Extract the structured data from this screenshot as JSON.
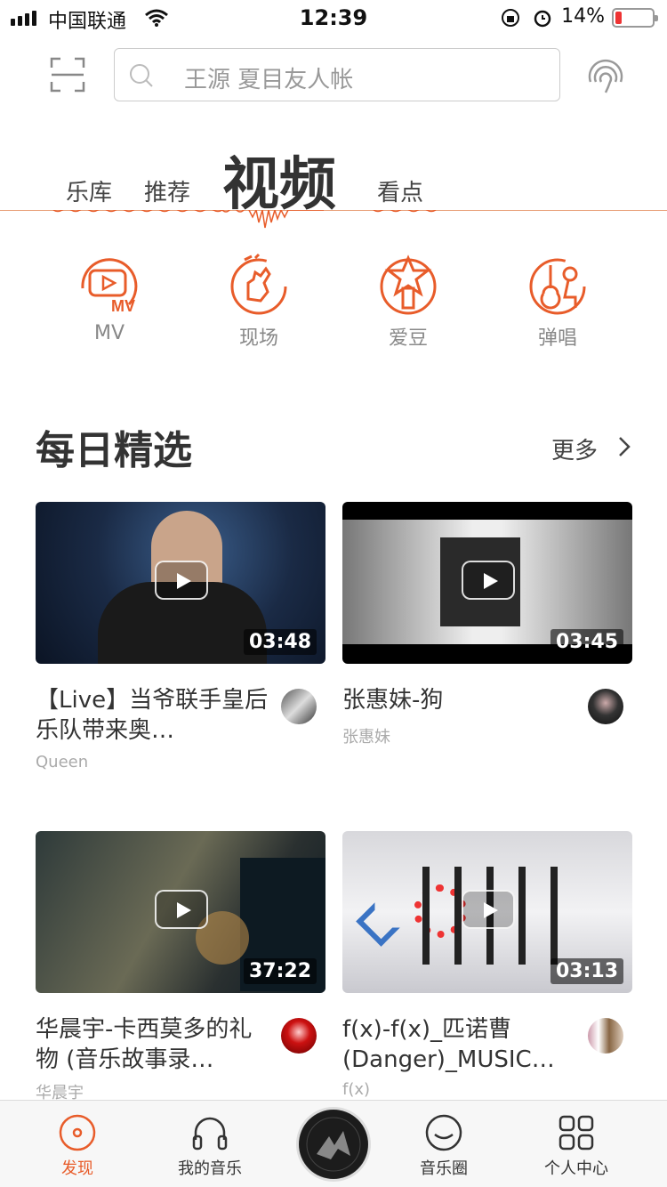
{
  "status": {
    "carrier": "中国联通",
    "time": "12:39",
    "battery": "14%"
  },
  "search": {
    "placeholder": "王源 夏目友人帐"
  },
  "tabs": [
    "乐库",
    "推荐",
    "视频",
    "看点"
  ],
  "active_tab": "视频",
  "categories": [
    {
      "label": "MV",
      "icon": "mv-icon"
    },
    {
      "label": "现场",
      "icon": "live-icon"
    },
    {
      "label": "爱豆",
      "icon": "idol-icon"
    },
    {
      "label": "弹唱",
      "icon": "guitar-icon"
    }
  ],
  "section": {
    "title": "每日精选",
    "more": "更多"
  },
  "videos": [
    {
      "title": "【Live】当爷联手皇后乐队带来奥…",
      "artist": "Queen",
      "duration": "03:48"
    },
    {
      "title": "张惠妹-狗",
      "artist": "张惠妹",
      "duration": "03:45"
    },
    {
      "title": "华晨宇-卡西莫多的礼物 (音乐故事录…",
      "artist": "华晨宇",
      "duration": "37:22"
    },
    {
      "title": "f(x)-f(x)_匹诺曹(Danger)_MUSIC…",
      "artist": "f(x)",
      "duration": "03:13"
    }
  ],
  "tabbar": [
    {
      "label": "发现",
      "active": true
    },
    {
      "label": "我的音乐",
      "active": false
    },
    {
      "label": "音乐圈",
      "active": false
    },
    {
      "label": "个人中心",
      "active": false
    }
  ],
  "colors": {
    "accent": "#e85c2a"
  }
}
